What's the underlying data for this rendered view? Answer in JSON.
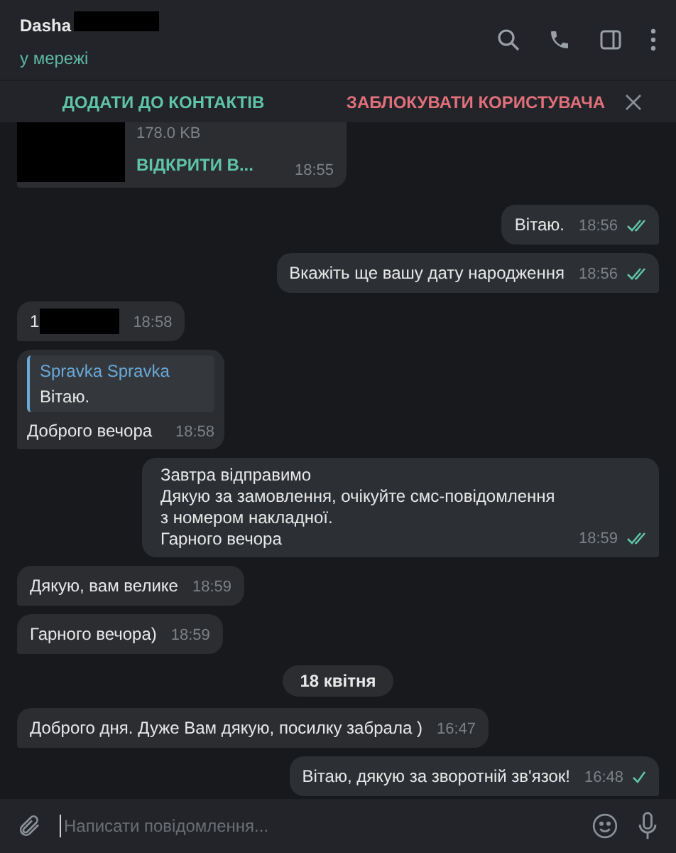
{
  "header": {
    "name": "Dasha",
    "name_redacted": true,
    "status": "у мережі"
  },
  "action_bar": {
    "add_contact": "ДОДАТИ ДО КОНТАКТІВ",
    "block_user": "ЗАБЛОКУВАТИ КОРИСТУВАЧА"
  },
  "messages": [
    {
      "kind": "file",
      "outgoing": false,
      "size": "178.0 KB",
      "link": "ВІДКРИТИ В...",
      "time": "18:55"
    },
    {
      "kind": "text",
      "outgoing": true,
      "text": "Вітаю.",
      "time": "18:56",
      "read": true
    },
    {
      "kind": "text",
      "outgoing": true,
      "text": "Вкажіть ще вашу дату народження",
      "time": "18:56",
      "read": true
    },
    {
      "kind": "redacted",
      "outgoing": false,
      "text": "1",
      "time": "18:58"
    },
    {
      "kind": "reply",
      "outgoing": false,
      "quote_author": "Spravka Spravka",
      "quote_text": "Вітаю.",
      "text": "Доброго вечора",
      "time": "18:58"
    },
    {
      "kind": "text",
      "outgoing": true,
      "lines": [
        "Завтра відправимо",
        "Дякую за замовлення, очікуйте смс-повідомлення з номером накладної.",
        "Гарного вечора"
      ],
      "time": "18:59",
      "read": true
    },
    {
      "kind": "text",
      "outgoing": false,
      "text": "Дякую, вам велике",
      "time": "18:59"
    },
    {
      "kind": "text",
      "outgoing": false,
      "text": "Гарного вечора)",
      "time": "18:59"
    },
    {
      "kind": "date",
      "text": "18 квітня"
    },
    {
      "kind": "text",
      "outgoing": false,
      "text": "Доброго дня. Дуже Вам дякую, посилку забрала )",
      "time": "16:47"
    },
    {
      "kind": "text",
      "outgoing": true,
      "text": "Вітаю, дякую за зворотній зв'язок!",
      "time": "16:48",
      "read": false
    }
  ],
  "composer": {
    "placeholder": "Написати повідомлення..."
  }
}
